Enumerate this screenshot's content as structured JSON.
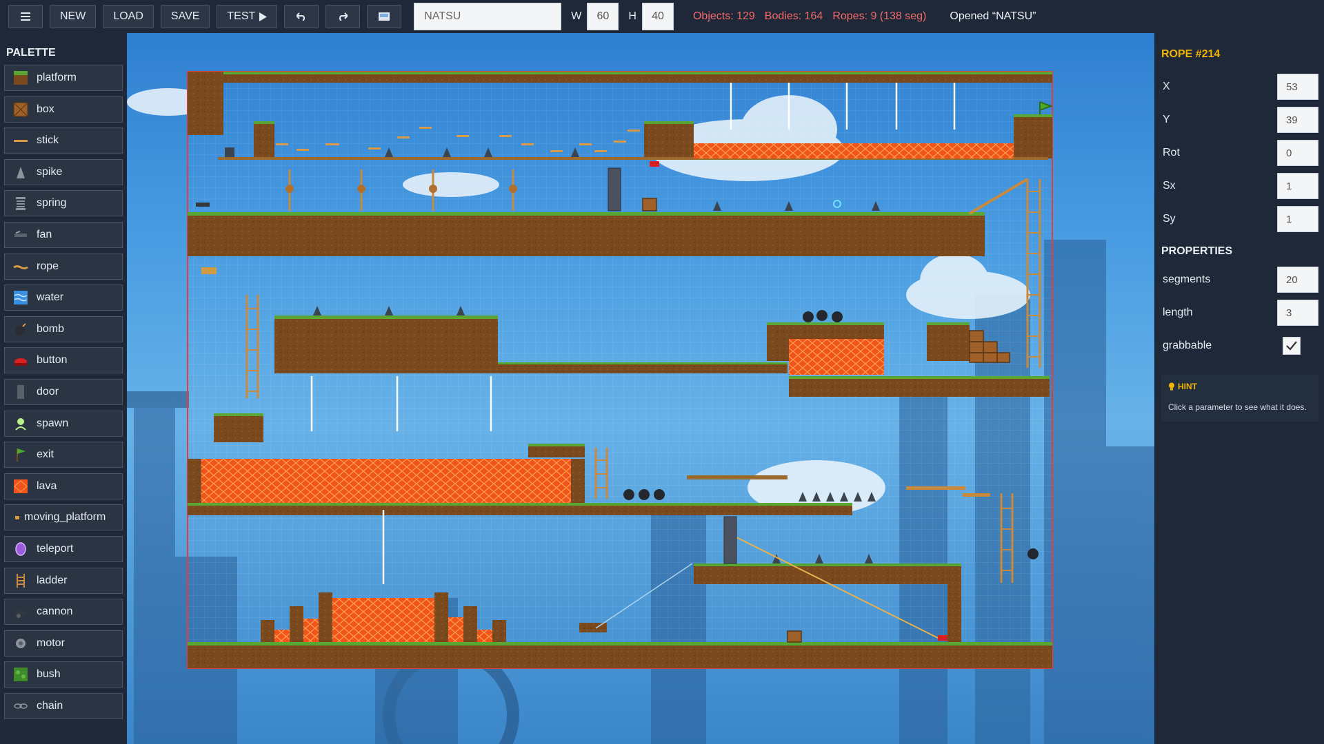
{
  "toolbar": {
    "menu_icon": "hamburger-icon",
    "new_label": "NEW",
    "load_label": "LOAD",
    "save_label": "SAVE",
    "test_label": "TEST",
    "test_icon": "play-icon",
    "undo_icon": "undo-icon",
    "redo_icon": "redo-icon",
    "screenshot_icon": "image-icon",
    "level_name": "NATSU",
    "w_label": "W",
    "w_value": "60",
    "h_label": "H",
    "h_value": "40",
    "stats": {
      "objects": "Objects: 129",
      "bodies": "Bodies: 164",
      "ropes": "Ropes: 9 (138 seg)"
    },
    "status": "Opened “NATSU”"
  },
  "palette": {
    "title": "PALETTE",
    "items": [
      {
        "id": "platform",
        "label": "platform",
        "icon": "platform-icon"
      },
      {
        "id": "box",
        "label": "box",
        "icon": "box-icon"
      },
      {
        "id": "stick",
        "label": "stick",
        "icon": "stick-icon"
      },
      {
        "id": "spike",
        "label": "spike",
        "icon": "spike-icon"
      },
      {
        "id": "spring",
        "label": "spring",
        "icon": "spring-icon"
      },
      {
        "id": "fan",
        "label": "fan",
        "icon": "fan-icon"
      },
      {
        "id": "rope",
        "label": "rope",
        "icon": "rope-icon"
      },
      {
        "id": "water",
        "label": "water",
        "icon": "water-icon"
      },
      {
        "id": "bomb",
        "label": "bomb",
        "icon": "bomb-icon"
      },
      {
        "id": "button",
        "label": "button",
        "icon": "button-icon"
      },
      {
        "id": "door",
        "label": "door",
        "icon": "door-icon"
      },
      {
        "id": "spawn",
        "label": "spawn",
        "icon": "spawn-icon"
      },
      {
        "id": "exit",
        "label": "exit",
        "icon": "exit-flag-icon"
      },
      {
        "id": "lava",
        "label": "lava",
        "icon": "lava-icon"
      },
      {
        "id": "moving_platform",
        "label": "moving_platform",
        "icon": "moving-platform-icon"
      },
      {
        "id": "teleport",
        "label": "teleport",
        "icon": "teleport-icon"
      },
      {
        "id": "ladder",
        "label": "ladder",
        "icon": "ladder-icon"
      },
      {
        "id": "cannon",
        "label": "cannon",
        "icon": "cannon-icon"
      },
      {
        "id": "motor",
        "label": "motor",
        "icon": "motor-icon"
      },
      {
        "id": "bush",
        "label": "bush",
        "icon": "bush-icon"
      },
      {
        "id": "chain",
        "label": "chain",
        "icon": "chain-icon"
      }
    ]
  },
  "inspector": {
    "title": "ROPE #214",
    "fields": [
      {
        "label": "X",
        "value": "53"
      },
      {
        "label": "Y",
        "value": "39"
      },
      {
        "label": "Rot",
        "value": "0"
      },
      {
        "label": "Sx",
        "value": "1"
      },
      {
        "label": "Sy",
        "value": "1"
      }
    ],
    "properties_title": "PROPERTIES",
    "properties": [
      {
        "label": "segments",
        "value": "20"
      },
      {
        "label": "length",
        "value": "3"
      }
    ],
    "grabbable_label": "grabbable",
    "grabbable": true,
    "hint_title": "HINT",
    "hint_icon": "lightbulb-icon",
    "hint_text": "Click a parameter to see what it does."
  },
  "colors": {
    "accent": "#f1b400",
    "stats": "#f26a6a",
    "lava": "#f0531c",
    "grass": "#5aa632",
    "dirt": "#7a4a1e",
    "selection": "#e04040"
  }
}
